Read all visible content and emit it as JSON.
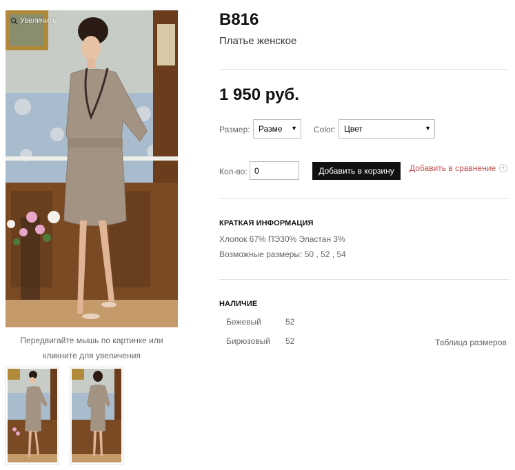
{
  "product": {
    "sku": "B816",
    "name": "Платье женское",
    "price": "1 950 руб."
  },
  "gallery": {
    "zoom_label": "Увеличить",
    "hint": "Передвигайте мышь по картинке или кликните для увеличения"
  },
  "options": {
    "size_label": "Размер:",
    "size_value": "Разме",
    "color_label": "Color:",
    "color_value": "Цвет"
  },
  "cart": {
    "qty_label": "Кол-во:",
    "qty_value": "0",
    "add_to_cart": "Добавить в корзину",
    "add_to_compare": "Добавить в сравнение"
  },
  "summary": {
    "heading": "КРАТКАЯ ИНФОРМАЦИЯ",
    "composition": "Хлопок 67% ПЭ30% Эластан 3%",
    "sizes": "Возможные размеры: 50 , 52 , 54"
  },
  "availability": {
    "heading": "НАЛИЧИЕ",
    "rows": [
      {
        "color": "Бежевый",
        "size": "52"
      },
      {
        "color": "Бирюзовый",
        "size": "52"
      }
    ],
    "size_table_link": "Таблица размеров"
  }
}
